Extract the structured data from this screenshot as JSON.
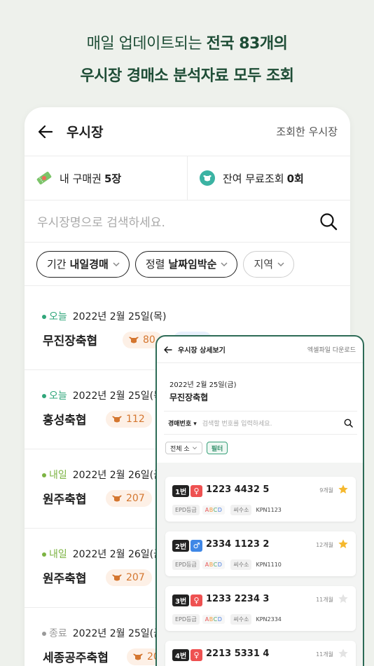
{
  "headline": {
    "line1_normal": "매일 업데이트되는",
    "line1_bold": "전국 83개의",
    "line2": "우시장 경매소 분석자료 모두 조회"
  },
  "main": {
    "title": "우시장",
    "right_link": "조회한 우시장",
    "tickets": {
      "label": "내 구매권",
      "value": "5장"
    },
    "free": {
      "label": "잔여 무료조회",
      "value": "0회"
    },
    "search_placeholder": "우시장명으로 검색하세요.",
    "filters": [
      {
        "prefix": "기간",
        "value": "내일경매"
      },
      {
        "prefix": "정렬",
        "value": "날짜임박순"
      },
      {
        "prefix": "지역",
        "value": ""
      }
    ],
    "markets": [
      {
        "status": "오늘",
        "status_color": "#2fa67a",
        "date": "2022년 2월 25일(목)",
        "name": "무진장축협",
        "count": "80",
        "tag": "송아지"
      },
      {
        "status": "오늘",
        "status_color": "#2fa67a",
        "date": "2022년 2월 25일(목",
        "name": "홍성축협",
        "count": "112",
        "tag": ""
      },
      {
        "status": "내일",
        "status_color": "#7cb342",
        "date": "2022년 2월 26일(금",
        "name": "원주축협",
        "count": "207",
        "tag": ""
      },
      {
        "status": "내일",
        "status_color": "#7cb342",
        "date": "2022년 2월 26일(금",
        "name": "원주축협",
        "count": "207",
        "tag": ""
      },
      {
        "status": "종료",
        "status_color": "#999999",
        "date": "2022년 2월 25일(금",
        "name": "세종공주축협",
        "count": "207",
        "tag": ""
      }
    ]
  },
  "detail": {
    "title": "우시장 상세보기",
    "excel": "엑셀파일 다운로드",
    "date": "2022년 2월 25일(금)",
    "name": "무진장축협",
    "search_label": "경매번호",
    "search_placeholder": "검색할 번호를 입력하세요.",
    "filter_all": "전체 소",
    "filter_btn": "필터",
    "cards": [
      {
        "num": "1번",
        "sex": "♀",
        "sex_type": "f",
        "id": "1223 4432 5",
        "age": "9개월",
        "starred": true,
        "epd_label": "EPD등급",
        "grade": [
          "A",
          "B",
          "C",
          "D"
        ],
        "sire_label": "씨수소",
        "sire": "KPN1123"
      },
      {
        "num": "2번",
        "sex": "♂",
        "sex_type": "m",
        "id": "2334 1123 2",
        "age": "12개월",
        "starred": true,
        "epd_label": "EPD등급",
        "grade": [
          "A",
          "B",
          "C",
          "D"
        ],
        "sire_label": "씨수소",
        "sire": "KPN1110"
      },
      {
        "num": "3번",
        "sex": "♀",
        "sex_type": "f",
        "id": "1233 2234 3",
        "age": "11개월",
        "starred": false,
        "epd_label": "EPD등급",
        "grade": [
          "A",
          "B",
          "C",
          "D"
        ],
        "sire_label": "씨수소",
        "sire": "KPN2334"
      },
      {
        "num": "4번",
        "sex": "♀",
        "sex_type": "f",
        "id": "2213 5331 4",
        "age": "11개월",
        "starred": false,
        "epd_label": "",
        "grade": [],
        "sire_label": "",
        "sire": ""
      }
    ]
  },
  "colors": {
    "brand": "#1e4d36",
    "accent": "#2d6b56",
    "count": "#d4762f",
    "star": "#f5b82e"
  }
}
